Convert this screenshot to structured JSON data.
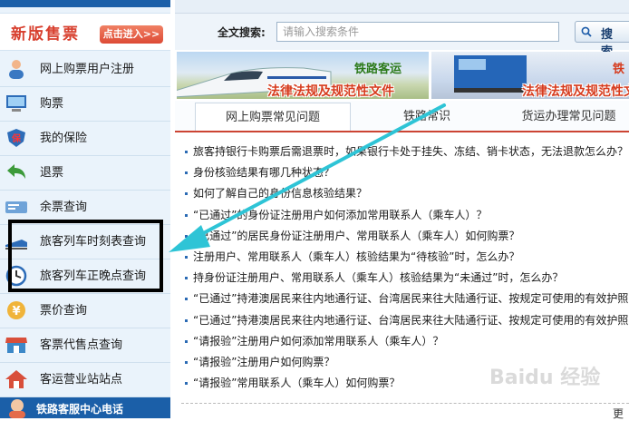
{
  "promo": {
    "title": "新版售票",
    "button": "点击进入>>"
  },
  "menu": [
    {
      "label": "网上购票用户注册",
      "icon": "user-register-icon"
    },
    {
      "label": "购票",
      "icon": "computer-icon"
    },
    {
      "label": "我的保险",
      "icon": "insurance-shield-icon"
    },
    {
      "label": "退票",
      "icon": "return-arrow-icon"
    },
    {
      "label": "余票查询",
      "icon": "ticket-icon"
    },
    {
      "label": "旅客列车时刻表查询",
      "icon": "train-icon"
    },
    {
      "label": "旅客列车正晚点查询",
      "icon": "clock-icon"
    },
    {
      "label": "票价查询",
      "icon": "yen-icon"
    },
    {
      "label": "客票代售点查询",
      "icon": "shop-icon"
    },
    {
      "label": "客运营业站站点",
      "icon": "house-icon"
    }
  ],
  "sidebar_bottom": {
    "text": "铁路客服中心电话"
  },
  "search": {
    "label": "全文搜索:",
    "placeholder": "请输入搜索条件",
    "button": "搜 索"
  },
  "banners": [
    {
      "top": "铁路客运",
      "main": "法律法规及规范性文件"
    },
    {
      "top": "铁",
      "main": "法律法规及规范性文件"
    }
  ],
  "tabs": [
    "网上购票常见问题",
    "铁路常识",
    "货运办理常见问题"
  ],
  "active_tab": 0,
  "faq": [
    "旅客持银行卡购票后需退票时，如果银行卡处于挂失、冻结、销卡状态，无法退款怎么办？",
    "身份核验结果有哪几种状态？",
    "如何了解自己的身份信息核验结果？",
    "“已通过”的身份证注册用户如何添加常用联系人（乘车人）？",
    "“已通过”的居民身份证注册用户、常用联系人（乘车人）如何购票？",
    "注册用户、常用联系人（乘车人）核验结果为“待核验”时，怎么办？",
    "持身份证注册用户、常用联系人（乘车人）核验结果为“未通过”时，怎么办？",
    "“已通过”持港澳居民来往内地通行证、台湾居民来往大陆通行证、按规定可使用的有效护照",
    "“已通过”持港澳居民来往内地通行证、台湾居民来往大陆通行证、按规定可使用的有效护照",
    "“请报验”注册用户如何添加常用联系人（乘车人）？",
    "“请报验”注册用户如何购票？",
    "“请报验”常用联系人（乘车人）如何购票？"
  ],
  "more": "更",
  "watermark": "Baidu 经验",
  "colors": {
    "nav_blue": "#1b5fa8",
    "promo_red": "#d8402f",
    "arrow": "#2ec4d6",
    "highlight": "#000000"
  }
}
